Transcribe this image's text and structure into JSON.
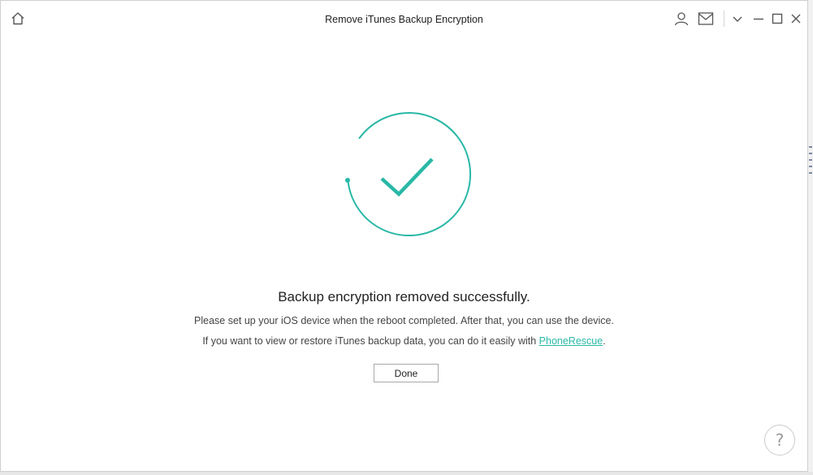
{
  "window": {
    "title": "Remove iTunes Backup Encryption",
    "icons": {
      "home": "home-icon",
      "account": "user-icon",
      "mail": "mail-icon",
      "menu": "chevron-down-icon",
      "minimize": "minimize-icon",
      "maximize": "maximize-icon",
      "close": "close-icon"
    }
  },
  "status": {
    "icon": "success-check-icon",
    "accent_color": "#29b8a6",
    "heading": "Backup encryption removed successfully.",
    "line1": "Please set up your iOS device when the reboot completed. After that, you can use the device.",
    "line2_prefix": "If you want to view or restore iTunes backup data, you can do it easily with ",
    "line2_link": "PhoneRescue",
    "line2_suffix": "."
  },
  "actions": {
    "done_label": "Done",
    "help_label": "?"
  }
}
